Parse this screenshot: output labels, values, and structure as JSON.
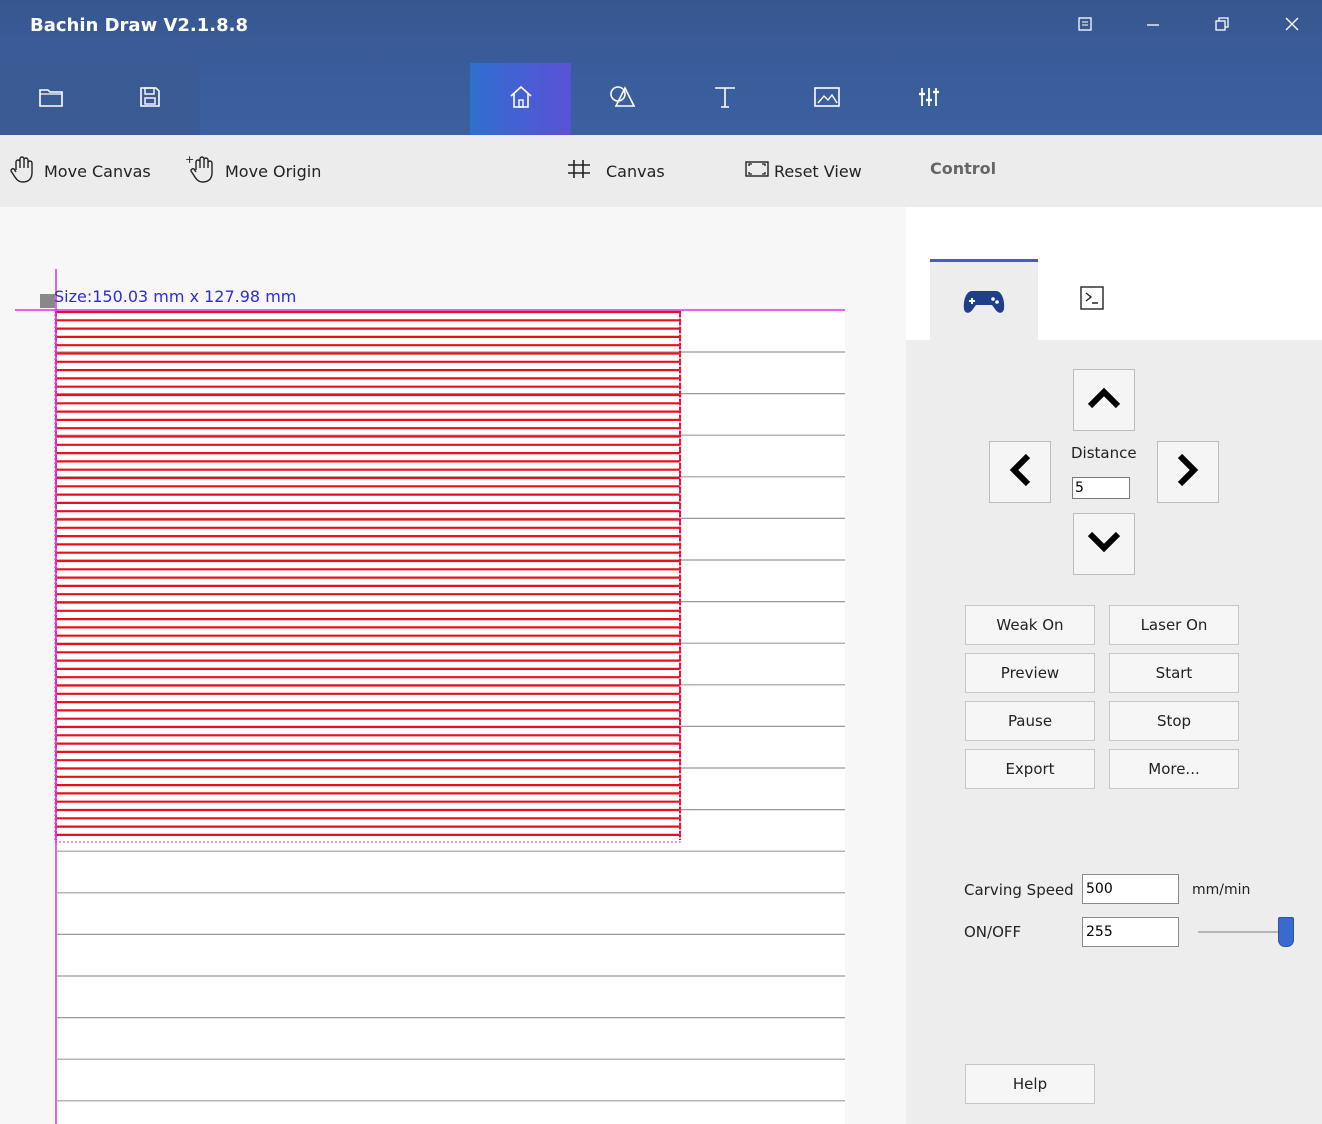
{
  "app": {
    "title": "Bachin Draw V2.1.8.8",
    "accent_color": "#3b5b99"
  },
  "window_controls": [
    {
      "name": "restore-layout-icon",
      "glyph": "⊟"
    },
    {
      "name": "minimize-icon",
      "glyph": "—"
    },
    {
      "name": "maximize-icon",
      "glyph": "❐"
    },
    {
      "name": "close-icon",
      "glyph": "✕"
    }
  ],
  "main_toolbar": [
    {
      "name": "open-folder-icon"
    },
    {
      "name": "save-icon"
    },
    {
      "name": "home-icon",
      "active": true
    },
    {
      "name": "shapes-icon"
    },
    {
      "name": "text-icon"
    },
    {
      "name": "image-icon"
    },
    {
      "name": "settings-sliders-icon"
    }
  ],
  "canvas_toolbar": {
    "move_canvas": "Move Canvas",
    "move_origin": "Move Origin",
    "canvas": "Canvas",
    "reset_view": "Reset View"
  },
  "control_panel": {
    "title": "Control",
    "tabs": [
      {
        "name": "gamepad-icon",
        "active": true
      },
      {
        "name": "terminal-icon",
        "active": false
      }
    ],
    "distance_label": "Distance",
    "distance_value": "5",
    "buttons": {
      "weak_on": "Weak On",
      "laser_on": "Laser On",
      "preview": "Preview",
      "start": "Start",
      "pause": "Pause",
      "stop": "Stop",
      "export": "Export",
      "more": "More..."
    },
    "carving_speed_label": "Carving  Speed",
    "carving_speed_value": "500",
    "speed_unit": "mm/min",
    "onoff_label": "ON/OFF",
    "onoff_value": "255",
    "onoff_slider_fraction": 1.0,
    "help": "Help"
  },
  "canvas": {
    "size_label": "Size:150.03 mm x 127.98 mm",
    "hatch_color": "#e8101c",
    "origin_color": "#e62ee6",
    "size_label_color": "#2b2bdd"
  }
}
